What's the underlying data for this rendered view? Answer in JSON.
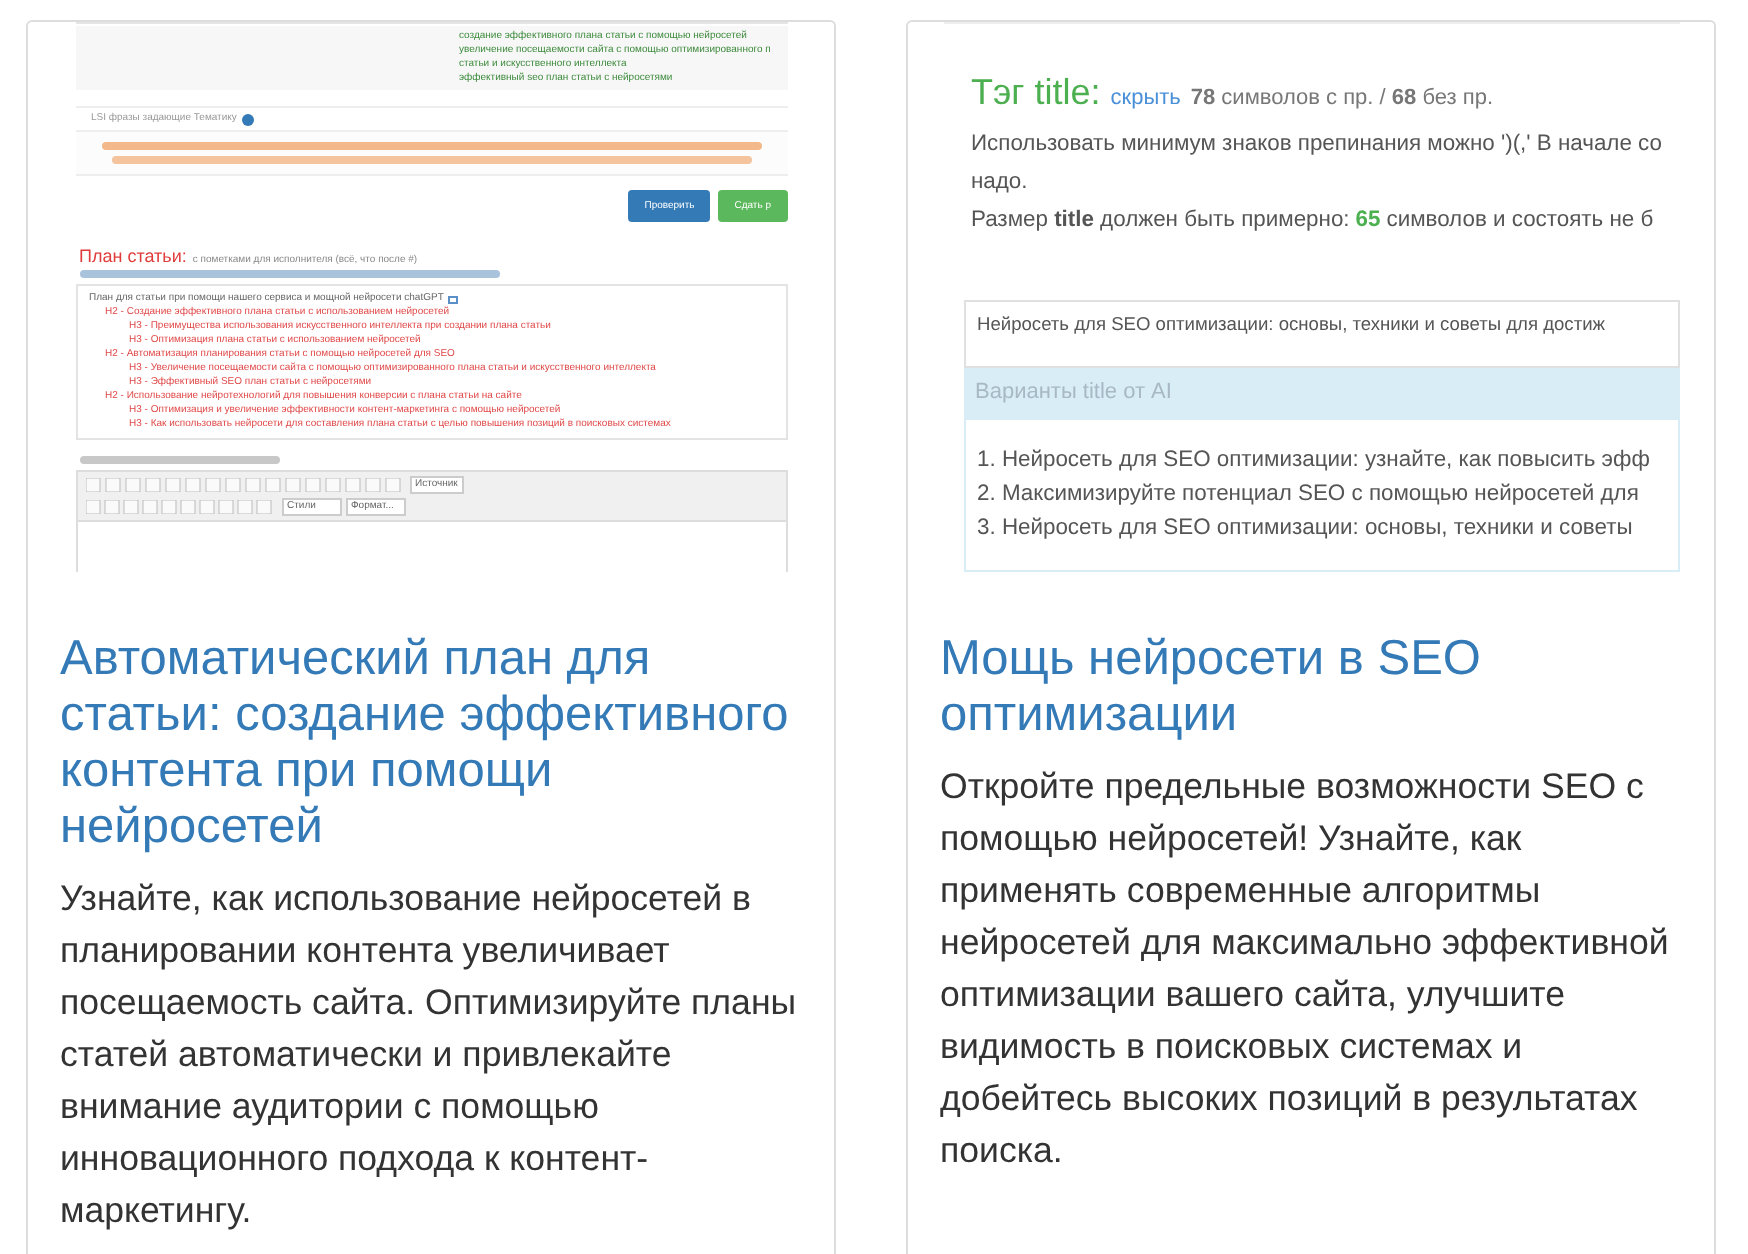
{
  "cards": [
    {
      "thumbnail": {
        "kind": "plan-editor",
        "green_lines": [
          "создание эффективного плана статьи с помощью нейросетей",
          "увеличение посещаемости сайта с помощью оптимизированного п",
          "статьи и искусственного интеллекта",
          "эффективный seo план статьи с нейросетями"
        ],
        "lsi_label": "LSI фразы задающие Тематику",
        "buttons": [
          {
            "label": "Проверить",
            "kind": "primary"
          },
          {
            "label": "Сдать р",
            "kind": "success"
          }
        ],
        "plan_title": "План статьи:",
        "plan_note": "с пометками для исполнителя (всё, что после #)",
        "outline_title": "План для статьи при помощи нашего сервиса и мощной нейросети chatGPT",
        "outline": [
          {
            "text": "H2 - Создание эффективного плана статьи с использованием нейросетей",
            "children": [
              {
                "text": "H3 - Преимущества использования искусственного интеллекта при создании плана статьи"
              },
              {
                "text": "H3 - Оптимизация плана статьи с использованием нейросетей"
              }
            ]
          },
          {
            "text": "H2 - Автоматизация планирования статьи с помощью нейросетей для SEO",
            "children": [
              {
                "text": "H3 - Увеличение посещаемости сайта с помощью оптимизированного плана статьи и искусственного интеллекта"
              },
              {
                "text": "H3 - Эффективный SEO план статьи с нейросетями"
              }
            ]
          },
          {
            "text": "H2 - Использование нейротехнологий для повышения конверсии с плана статьи на сайте",
            "children": [
              {
                "text": "H3 - Оптимизация и увеличение эффективности контент-маркетинга с помощью нейросетей"
              },
              {
                "text": "H3 - Как использовать нейросети для составления плана статьи с целью повышения позиций в поисковых системах"
              }
            ]
          }
        ],
        "toolbar_source": "Источник",
        "toolbar_style": "Стили",
        "toolbar_format": "Формат..."
      },
      "title": "Автоматический план для статьи: создание эффективного контента при помощи нейросетей",
      "description": "Узнайте, как использование нейросетей в планировании контента увеличивает посещаемость сайта. Оптимизируйте планы статей автоматически и привлекайте внимание аудитории с помощью инновационного подхода к контент-маркетингу."
    },
    {
      "thumbnail": {
        "kind": "title-tool",
        "heading": "Тэг title:",
        "hide_link": "скрыть",
        "counts": "**78** символов с пр. / **68** без пр.",
        "rule_lines": [
          "Использовать минимум знаков препинания можно ')(,' В начале со",
          "надо."
        ],
        "size_prefix": "Размер **title** должен быть примерно:",
        "size_value": "65",
        "size_suffix": "символов и состоять не б",
        "field_value": "Нейросеть для SEO оптимизации: основы, техники и советы для достиж",
        "variants_header": "Варианты title от AI",
        "variants": [
          "1. Нейросеть для SEO оптимизации: узнайте, как повысить эфф",
          "2. Максимизируйте потенциал SEO с помощью нейросетей для",
          "3. Нейросеть для SEO оптимизации: основы, техники и советы"
        ]
      },
      "title": "Мощь нейросети в SEO оптимизации",
      "description": "Откройте предельные возможности SEO с помощью нейросетей! Узнайте, как применять современные алгоритмы нейросетей для максимально эффективной оптимизации вашего сайта, улучшите видимость в поисковых системах и добейтесь высоких позиций в результатах поиска."
    }
  ]
}
